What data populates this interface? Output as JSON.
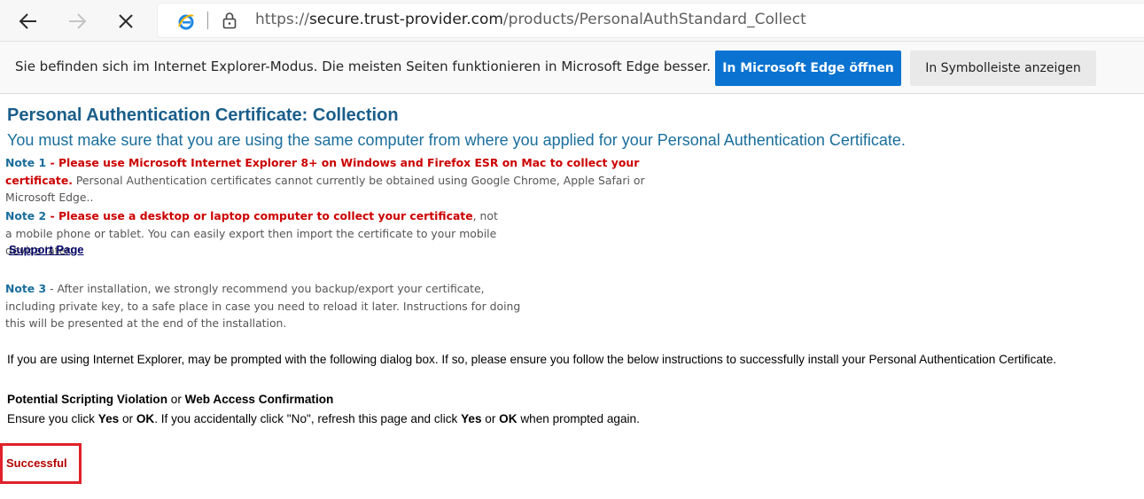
{
  "browser": {
    "url_scheme": "https://",
    "url_host": "secure.trust-provider.com",
    "url_path": "/products/PersonalAuthStandard_Collect",
    "icons": {
      "back": "back-arrow-icon",
      "forward": "forward-arrow-icon",
      "stop": "close-icon",
      "ie": "internet-explorer-icon",
      "lock": "lock-icon"
    }
  },
  "infobar": {
    "message": "Sie befinden sich im Internet Explorer-Modus. Die meisten Seiten funktionieren in Microsoft Edge besser.",
    "open_edge_label": "In Microsoft Edge öffnen",
    "show_toolbar_label": "In Symbolleiste anzeigen",
    "accent_color": "#0a73d1"
  },
  "page": {
    "title": "Personal Authentication Certificate: Collection",
    "subtitle": "You must make sure that you are using the same computer from where you applied for your Personal Authentication Certificate.",
    "note1": {
      "label": "Note 1",
      "dash": " - ",
      "emphasis": "Please use Microsoft Internet Explorer 8+ on Windows and Firefox ESR on Mac to collect your certificate.",
      "rest": " Personal Authentication certificates cannot currently be obtained using Google Chrome, Apple Safari or Microsoft Edge.."
    },
    "note2": {
      "label": "Note 2",
      "dash": " - ",
      "emphasis": "Please use a desktop or laptop computer to collect your certificate",
      "rest": ", not a mobile phone or tablet. You can easily export then import the certificate to your mobile device later."
    },
    "support_link": "Support Page",
    "note3": {
      "label": "Note 3",
      "rest": " - After installation, we strongly recommend you backup/export your certificate, including private key, to a safe place in case you need to reload it later. Instructions for doing this will be presented at the end of the installation."
    },
    "ie_info": "If you are using Internet Explorer, may be prompted with the following dialog box. If so, please ensure you follow the below instructions to successfully install your Personal Authentication Certificate.",
    "warning": {
      "heading_a": "Potential Scripting Violation",
      "heading_or": " or ",
      "heading_b": "Web Access Confirmation",
      "body_1": "Ensure you click ",
      "yes1": "Yes",
      "or1": " or ",
      "ok1": "OK",
      "body_2": ". If you accidentally click \"No\", refresh this page and click ",
      "yes2": "Yes",
      "or2": " or ",
      "ok2": "OK",
      "body_3": " when prompted again."
    },
    "status": "Successful",
    "highlight_color": "#e0202a"
  }
}
